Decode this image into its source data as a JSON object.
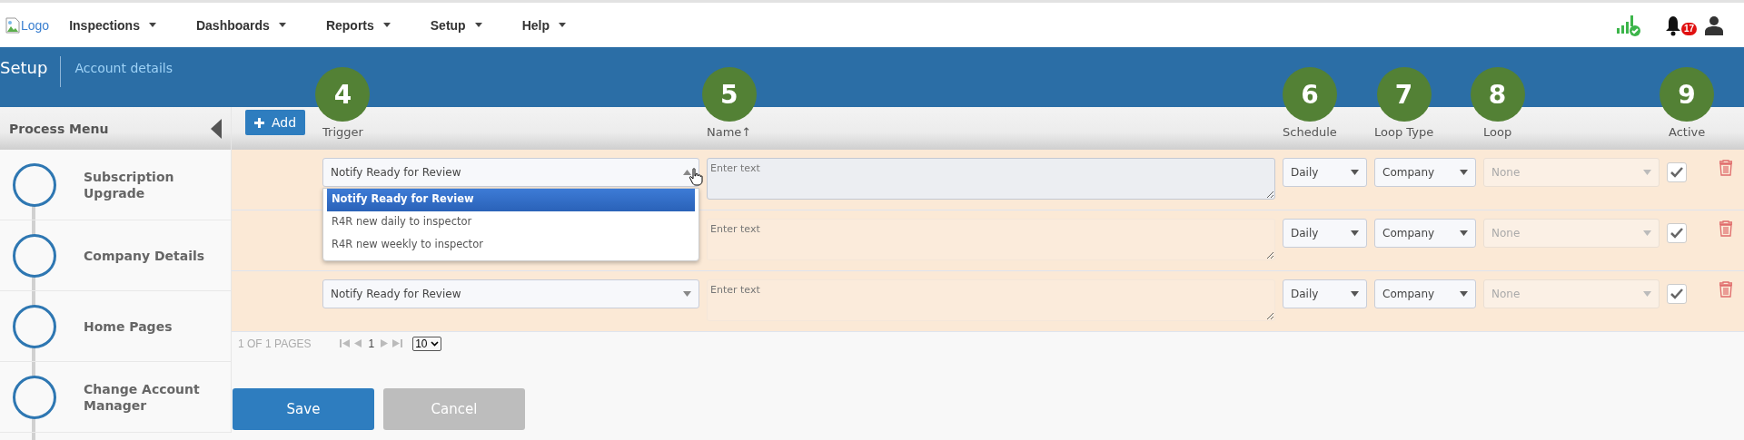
{
  "top_nav": {
    "logo": "Logo",
    "menus": [
      {
        "label": "Inspections"
      },
      {
        "label": "Dashboards"
      },
      {
        "label": "Reports"
      },
      {
        "label": "Setup"
      },
      {
        "label": "Help"
      }
    ],
    "notification_count": "17"
  },
  "header": {
    "title": "Setup",
    "breadcrumb": "Account details"
  },
  "sidebar": {
    "title": "Process Menu",
    "items": [
      {
        "label": "Subscription Upgrade"
      },
      {
        "label": "Company Details"
      },
      {
        "label": "Home Pages"
      },
      {
        "label": "Change Account Manager"
      }
    ]
  },
  "table": {
    "add_button": "Add",
    "columns": [
      {
        "label": "Trigger",
        "marker": "4"
      },
      {
        "label": "Name↑",
        "marker": "5"
      },
      {
        "label": "Schedule",
        "marker": "6"
      },
      {
        "label": "Loop Type",
        "marker": "7"
      },
      {
        "label": "Loop",
        "marker": "8"
      },
      {
        "label": "Active",
        "marker": "9"
      }
    ],
    "rows": [
      {
        "trigger": "Notify Ready for Review",
        "open": true,
        "options": [
          {
            "label": "Notify Ready for Review",
            "selected": true
          },
          {
            "label": "R4R new daily to inspector",
            "selected": false
          },
          {
            "label": "R4R new weekly to inspector",
            "selected": false
          }
        ],
        "name_placeholder": "Enter text",
        "name_focused": true,
        "schedule": "Daily",
        "loop_type": "Company",
        "loop": "None",
        "loop_disabled": true,
        "active": true
      },
      {
        "name_placeholder": "Enter text",
        "name_focused": false,
        "schedule": "Daily",
        "loop_type": "Company",
        "loop": "None",
        "loop_disabled": true,
        "active": true
      },
      {
        "trigger": "Notify Ready for Review",
        "open": false,
        "name_placeholder": "Enter text",
        "name_focused": false,
        "schedule": "Daily",
        "loop_type": "Company",
        "loop": "None",
        "loop_disabled": true,
        "active": true
      }
    ]
  },
  "pagination": {
    "summary": "1 OF 1 PAGES",
    "page": "1",
    "page_size": "10"
  },
  "buttons": [
    {
      "label": "Save",
      "kind": "primary"
    },
    {
      "label": "Cancel",
      "kind": "secondary"
    }
  ]
}
